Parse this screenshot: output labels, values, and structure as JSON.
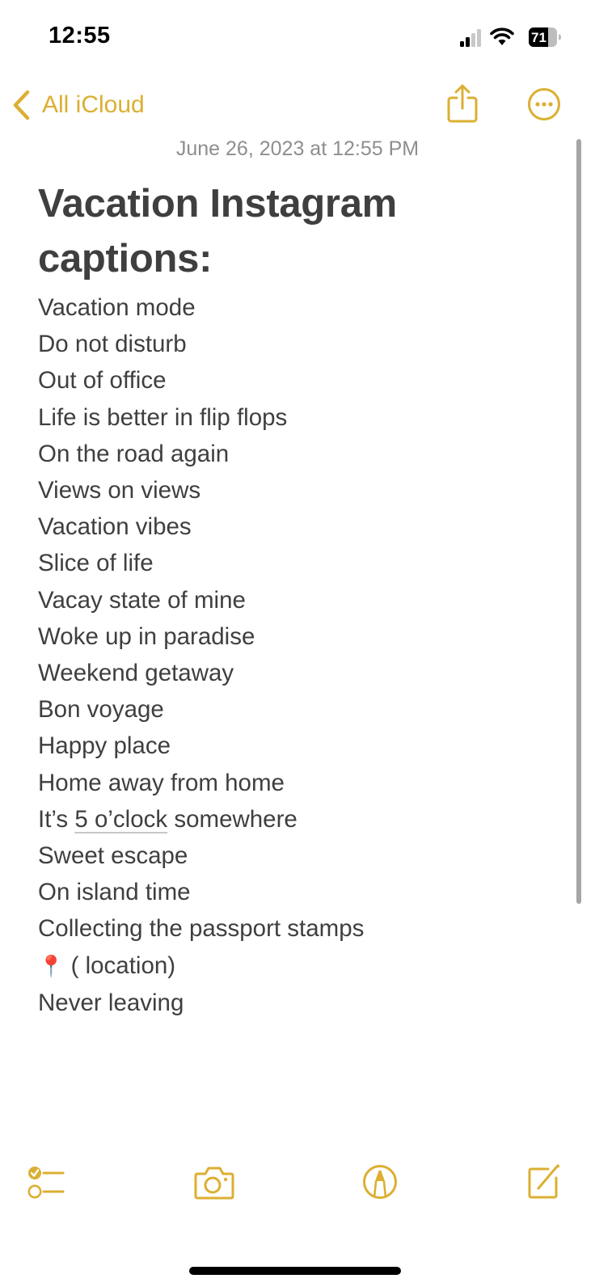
{
  "status_bar": {
    "time": "12:55",
    "battery_level": "71",
    "signal_bars_filled": 2,
    "signal_bars_total": 4
  },
  "nav": {
    "back_label": "All iCloud",
    "back_icon": "chevron-left-icon",
    "share_icon": "share-icon",
    "more_icon": "ellipsis-circle-icon"
  },
  "note": {
    "date": "June 26, 2023 at 12:55 PM",
    "title": "Vacation Instagram captions:",
    "lines": [
      "Vacation mode",
      "Do not disturb",
      "Out of office",
      "Life is better in flip flops",
      "On the road again",
      "Views on views",
      "Vacation vibes",
      "Slice of life",
      "Vacay state of mine",
      "Woke up in paradise",
      "Weekend getaway",
      "Bon voyage",
      "Happy place",
      "Home away from home"
    ],
    "line_with_link": {
      "before": "It’s ",
      "link": "5 o’clock",
      "after": " somewhere"
    },
    "lines_after": [
      "Sweet escape",
      "On island time",
      "Collecting the passport stamps"
    ],
    "location_line": {
      "emoji": "📍",
      "text": " ( location)"
    },
    "last_line": "Never leaving"
  },
  "toolbar": {
    "checklist_icon": "checklist-icon",
    "camera_icon": "camera-icon",
    "markup_icon": "markup-pen-icon",
    "compose_icon": "compose-icon"
  },
  "colors": {
    "accent": "#dcaf32",
    "text": "#3f3f3f",
    "secondary_text": "#8e8e8e"
  }
}
